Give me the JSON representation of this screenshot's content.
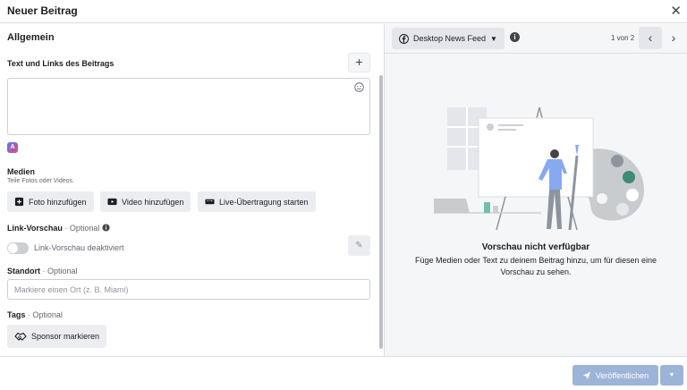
{
  "dialog": {
    "title": "Neuer Beitrag",
    "close_icon": "close-icon"
  },
  "form": {
    "section_title": "Allgemein",
    "text_links_label": "Text und Links des Beitrags",
    "add_label": "+",
    "media": {
      "label": "Medien",
      "sub": "Teile Fotos oder Videos.",
      "buttons": [
        "Foto hinzufügen",
        "Video hinzufügen",
        "Live-Übertragung starten"
      ]
    },
    "link_preview": {
      "label": "Link-Vorschau",
      "optional": "· Optional",
      "toggle_label": "Link-Vorschau deaktiviert"
    },
    "location": {
      "label": "Standort",
      "optional": "· Optional",
      "placeholder": "Markiere einen Ort (z. B. Miami)"
    },
    "tags": {
      "label": "Tags",
      "optional": "· Optional",
      "sponsor_button": "Sponsor markieren"
    }
  },
  "preview": {
    "placement": "Desktop News Feed",
    "pager": "1 von 2",
    "unavailable_title": "Vorschau nicht verfügbar",
    "unavailable_text": "Füge Medien oder Text zu deinem Beitrag hinzu, um für diesen eine Vorschau zu sehen."
  },
  "footer": {
    "publish_label": "Veröffentlichen"
  },
  "colors": {
    "publish_disabled": "#9cb4d8",
    "toggle_off": "#ccd0d5",
    "accent_green": "#3d8b74"
  }
}
